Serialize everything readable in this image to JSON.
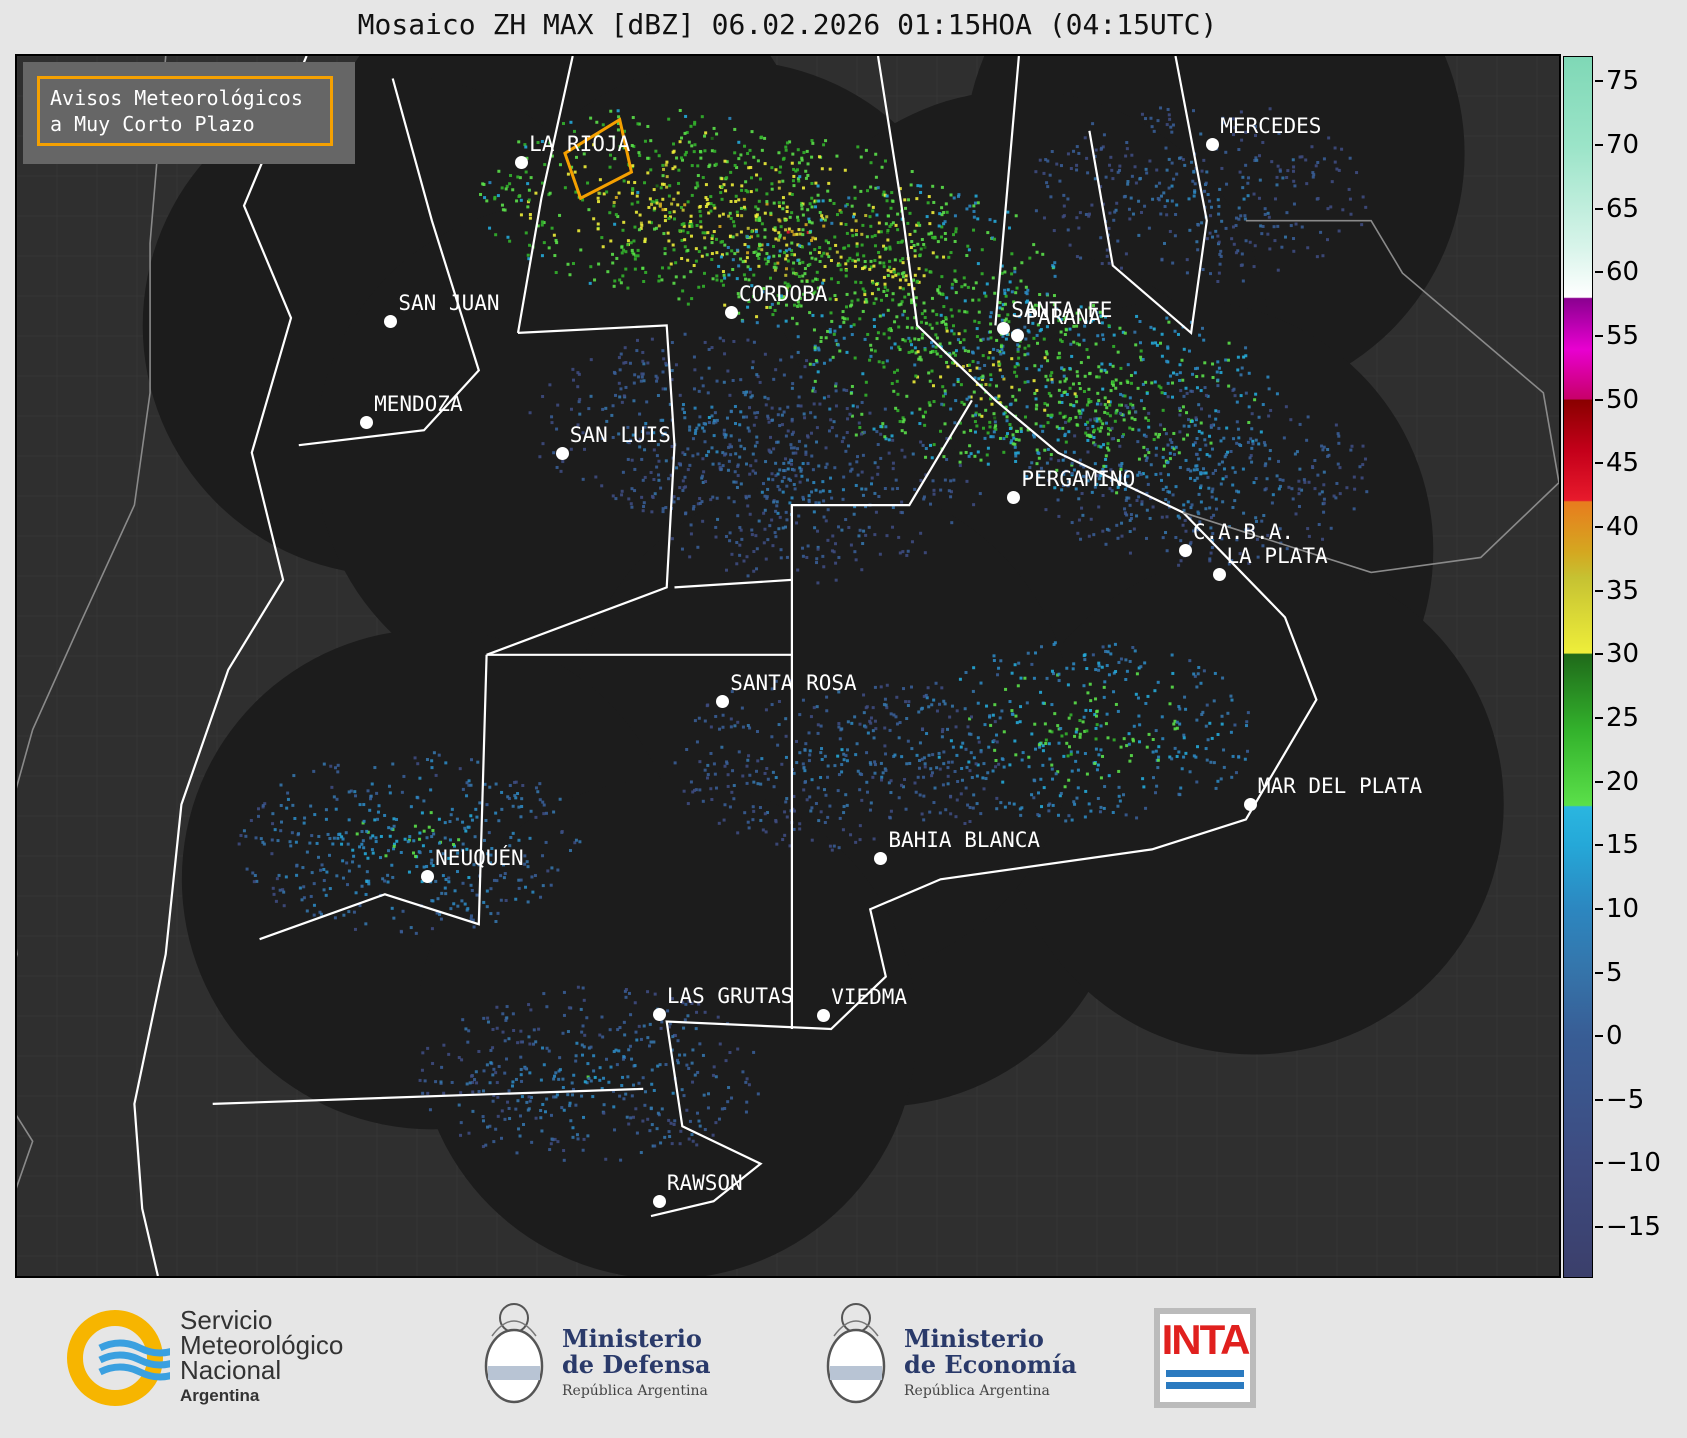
{
  "title": "Mosaico ZH MAX [dBZ] 06.02.2026 01:15HOA (04:15UTC)",
  "avisos": {
    "line1": "Avisos Meteorológicos",
    "line2": "a Muy Corto Plazo",
    "border_color": "#f5a000"
  },
  "cities": [
    {
      "name": "LA RIOJA",
      "lon": -66.86,
      "lat": -29.41
    },
    {
      "name": "MERCEDES",
      "lon": -58.03,
      "lat": -29.18
    },
    {
      "name": "CORDOBA",
      "lon": -64.18,
      "lat": -31.42
    },
    {
      "name": "SAN JUAN",
      "lon": -68.53,
      "lat": -31.54
    },
    {
      "name": "SANTA FE",
      "lon": -60.7,
      "lat": -31.63
    },
    {
      "name": "PARANA",
      "lon": -60.52,
      "lat": -31.73
    },
    {
      "name": "MENDOZA",
      "lon": -68.84,
      "lat": -32.89
    },
    {
      "name": "SAN LUIS",
      "lon": -66.34,
      "lat": -33.3
    },
    {
      "name": "PERGAMINO",
      "lon": -60.57,
      "lat": -33.89
    },
    {
      "name": "C.A.B.A.",
      "lon": -58.38,
      "lat": -34.6
    },
    {
      "name": "LA PLATA",
      "lon": -57.95,
      "lat": -34.92
    },
    {
      "name": "SANTA ROSA",
      "lon": -64.29,
      "lat": -36.62
    },
    {
      "name": "MAR DEL PLATA",
      "lon": -57.55,
      "lat": -38.0
    },
    {
      "name": "BAHIA BLANCA",
      "lon": -62.27,
      "lat": -38.72
    },
    {
      "name": "NEUQUÉN",
      "lon": -68.06,
      "lat": -38.95
    },
    {
      "name": "LAS GRUTAS",
      "lon": -65.1,
      "lat": -40.8
    },
    {
      "name": "VIEDMA",
      "lon": -63.0,
      "lat": -40.81
    },
    {
      "name": "RAWSON",
      "lon": -65.1,
      "lat": -43.3
    }
  ],
  "radars": [
    {
      "lon": -66.3,
      "lat": -29.9
    },
    {
      "lon": -58.0,
      "lat": -29.3
    },
    {
      "lon": -64.2,
      "lat": -31.4
    },
    {
      "lon": -68.5,
      "lat": -31.6
    },
    {
      "lon": -60.5,
      "lat": -31.8
    },
    {
      "lon": -66.3,
      "lat": -33.3
    },
    {
      "lon": -60.5,
      "lat": -33.9
    },
    {
      "lon": -58.4,
      "lat": -34.6
    },
    {
      "lon": -62.3,
      "lat": -38.7
    },
    {
      "lon": -57.5,
      "lat": -38.0
    },
    {
      "lon": -63.0,
      "lat": -37.0
    },
    {
      "lon": -68.0,
      "lat": -39.0
    },
    {
      "lon": -65.0,
      "lat": -41.0
    }
  ],
  "colorbar": {
    "min": -19,
    "max": 77,
    "ticks": [
      75,
      70,
      65,
      60,
      55,
      50,
      45,
      40,
      35,
      30,
      25,
      20,
      15,
      10,
      5,
      0,
      -5,
      -10,
      -15
    ],
    "tick_labels": [
      "75",
      "70",
      "65",
      "60",
      "55",
      "50",
      "45",
      "40",
      "35",
      "30",
      "25",
      "20",
      "15",
      "10",
      "5",
      "0",
      "−5",
      "−10",
      "−15"
    ],
    "stops": [
      {
        "v": -19,
        "c": "#3b3f6b"
      },
      {
        "v": -10,
        "c": "#3e4b80"
      },
      {
        "v": 0,
        "c": "#385d95"
      },
      {
        "v": 5,
        "c": "#3574aa"
      },
      {
        "v": 10,
        "c": "#2c87c0"
      },
      {
        "v": 15,
        "c": "#25a8d8"
      },
      {
        "v": 18,
        "c": "#2ab6e0"
      },
      {
        "v": 18.1,
        "c": "#5be04a"
      },
      {
        "v": 24,
        "c": "#33b22c"
      },
      {
        "v": 30,
        "c": "#1f6a1a"
      },
      {
        "v": 30.1,
        "c": "#eeee3a"
      },
      {
        "v": 36,
        "c": "#c6c232"
      },
      {
        "v": 38,
        "c": "#d4a820"
      },
      {
        "v": 42,
        "c": "#e87c1e"
      },
      {
        "v": 42.1,
        "c": "#e81a2c"
      },
      {
        "v": 46,
        "c": "#c4001a"
      },
      {
        "v": 50,
        "c": "#8a0000"
      },
      {
        "v": 50.1,
        "c": "#c8006a"
      },
      {
        "v": 54,
        "c": "#e800d0"
      },
      {
        "v": 58,
        "c": "#8a0090"
      },
      {
        "v": 58.1,
        "c": "#ffffff"
      },
      {
        "v": 62,
        "c": "#d8f4ea"
      },
      {
        "v": 70,
        "c": "#9be4c8"
      },
      {
        "v": 77,
        "c": "#7fd8b6"
      }
    ]
  },
  "echoes": [
    {
      "lon": -63.5,
      "lat": -30.3,
      "intensity": 38
    },
    {
      "lon": -65.2,
      "lat": -29.9,
      "intensity": 35
    },
    {
      "lon": -62.2,
      "lat": -30.9,
      "intensity": 30
    },
    {
      "lon": -61.0,
      "lat": -32.2,
      "intensity": 32
    },
    {
      "lon": -59.4,
      "lat": -32.6,
      "intensity": 26
    },
    {
      "lon": -64.6,
      "lat": -32.9,
      "intensity": 10
    },
    {
      "lon": -63.2,
      "lat": -33.8,
      "intensity": 9
    },
    {
      "lon": -58.2,
      "lat": -33.6,
      "intensity": 11
    },
    {
      "lon": -59.7,
      "lat": -37.0,
      "intensity": 22
    },
    {
      "lon": -62.8,
      "lat": -37.4,
      "intensity": 10
    },
    {
      "lon": -66.0,
      "lat": -41.6,
      "intensity": 12
    },
    {
      "lon": -68.3,
      "lat": -38.5,
      "intensity": 17
    },
    {
      "lon": -58.2,
      "lat": -29.8,
      "intensity": 9
    }
  ],
  "logos": {
    "smn_line1": "Servicio",
    "smn_line2": "Meteorológico",
    "smn_line3": "Nacional",
    "smn_line4": "Argentina",
    "defensa_line1": "Ministerio",
    "defensa_line2": "de Defensa",
    "defensa_sub": "República Argentina",
    "economia_line1": "Ministerio",
    "economia_line2": "de Economía",
    "economia_sub": "República Argentina",
    "inta": "INTA",
    "smn_yellow": "#f7b500",
    "smn_blue": "#3aa0e0",
    "inta_red": "#e0201e",
    "inta_blue": "#2a7ac0"
  }
}
